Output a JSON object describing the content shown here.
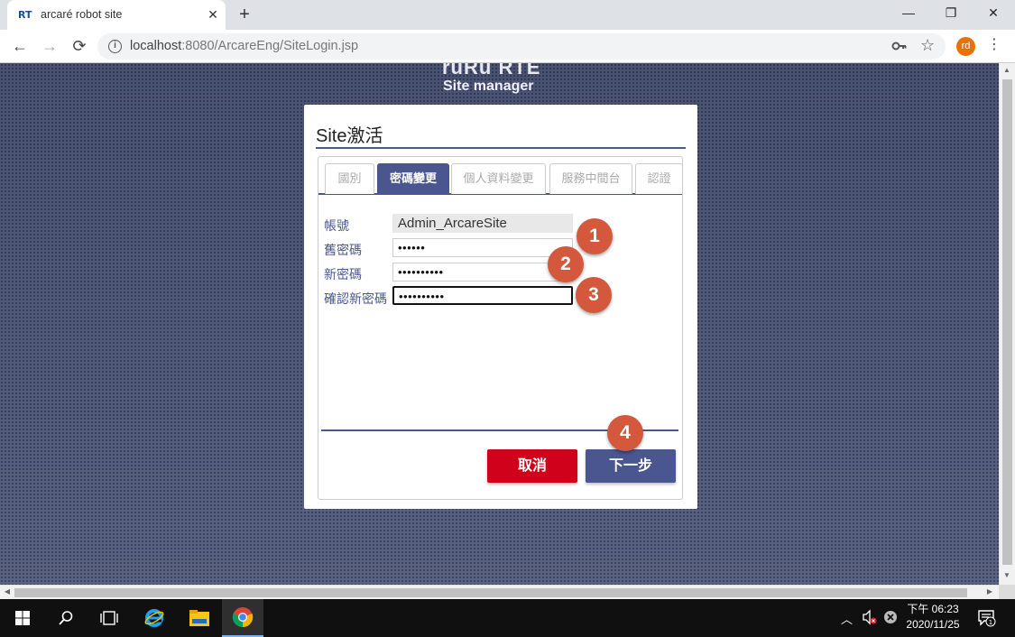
{
  "browser": {
    "tab_favicon": "RT",
    "tab_title": "arcaré robot site",
    "tab_close": "✕",
    "new_tab": "+",
    "window_controls": {
      "minimize": "—",
      "restore": "❐",
      "close": "✕"
    },
    "nav": {
      "back": "←",
      "forward": "→",
      "reload": "⟳"
    },
    "url_host": "localhost",
    "url_rest": ":8080/ArcareEng/SiteLogin.jsp",
    "profile_initials": "rd",
    "menu": "⋮"
  },
  "page": {
    "brand_title": "ruRu RTE",
    "brand_subtitle": "Site manager",
    "dialog_title": "Site激活",
    "tabs": [
      {
        "label": "國別",
        "active": false
      },
      {
        "label": "密碼變更",
        "active": true
      },
      {
        "label": "個人資料變更",
        "active": false
      },
      {
        "label": "服務中間台",
        "active": false
      },
      {
        "label": "認證",
        "active": false
      }
    ],
    "form": {
      "account_label": "帳號",
      "account_value": "Admin_ArcareSite",
      "old_password_label": "舊密碼",
      "old_password_value": "••••••",
      "new_password_label": "新密碼",
      "new_password_value": "••••••••••",
      "confirm_password_label": "確認新密碼",
      "confirm_password_value": "••••••••••"
    },
    "buttons": {
      "cancel": "取消",
      "next": "下一步"
    },
    "step_markers": [
      "1",
      "2",
      "3",
      "4"
    ]
  },
  "taskbar": {
    "clock_time": "下午 06:23",
    "clock_date": "2020/11/25",
    "notification_count": "1"
  },
  "colors": {
    "accent": "#4a5690",
    "cancel": "#d0021b",
    "marker": "#d3583c"
  }
}
